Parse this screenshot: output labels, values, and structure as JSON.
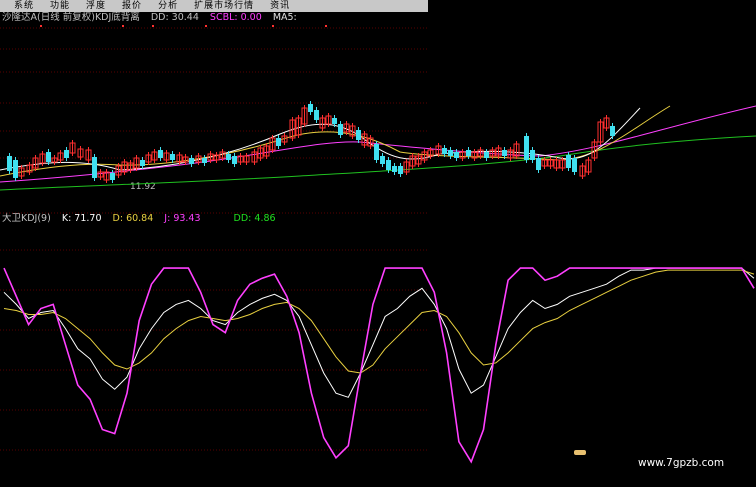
{
  "menu": [
    "系统",
    "功能",
    "浮度",
    "报价",
    "分析",
    "扩展市场行情",
    "资讯"
  ],
  "main_panel": {
    "stock_label": "沙隆达A(日线 前复权)",
    "indicator_label": "KDJ底背离",
    "dd_label": "DD: 30.44",
    "scbl_label": "SCBL: 0.00",
    "ma_label": "MA5:",
    "low_marker": "11.92"
  },
  "kdj_panel": {
    "title": "大卫KDJ(9)",
    "k": "K: 71.70",
    "d": "D: 60.84",
    "j": "J: 93.43",
    "dd": "DD: 4.86"
  },
  "watermark": "www.7gpzb.com",
  "colors": {
    "bg": "#000000",
    "up": "#ff3030",
    "down": "#40e0f0",
    "k_line": "#ffffff",
    "d_line": "#e8d040",
    "j_line": "#ff40ff",
    "grid": "#b00000",
    "ma_white": "#ffffff",
    "ma_yellow": "#e8d040",
    "ma_pink": "#ff40ff",
    "ma_green": "#20c020"
  },
  "chart_data": {
    "type": "line",
    "series": [
      {
        "name": "K",
        "values": [
          88,
          82,
          75,
          78,
          79,
          70,
          60,
          55,
          45,
          40,
          46,
          60,
          70,
          78,
          82,
          84,
          80,
          74,
          72,
          78,
          82,
          85,
          87,
          84,
          76,
          62,
          48,
          38,
          36,
          48,
          62,
          76,
          80,
          86,
          90,
          82,
          70,
          50,
          38,
          42,
          56,
          70,
          78,
          84,
          80,
          82,
          86,
          88,
          90,
          92,
          96,
          99,
          99,
          100,
          100,
          100,
          100,
          100,
          100,
          100,
          100,
          95
        ]
      },
      {
        "name": "D",
        "values": [
          80,
          79,
          77,
          77,
          78,
          75,
          70,
          65,
          58,
          52,
          50,
          53,
          58,
          65,
          70,
          74,
          76,
          75,
          74,
          75,
          77,
          80,
          82,
          83,
          80,
          74,
          65,
          56,
          49,
          48,
          52,
          60,
          66,
          72,
          78,
          79,
          76,
          68,
          58,
          52,
          53,
          58,
          64,
          70,
          73,
          75,
          79,
          82,
          85,
          88,
          91,
          94,
          96,
          98,
          99,
          99,
          99,
          99,
          99,
          99,
          99,
          97
        ]
      },
      {
        "name": "J",
        "values": [
          100,
          86,
          72,
          80,
          82,
          62,
          42,
          35,
          20,
          18,
          38,
          74,
          92,
          100,
          100,
          100,
          88,
          72,
          68,
          84,
          92,
          95,
          97,
          86,
          68,
          38,
          16,
          6,
          12,
          48,
          82,
          100,
          100,
          100,
          100,
          88,
          58,
          14,
          4,
          20,
          62,
          94,
          100,
          100,
          94,
          96,
          100,
          100,
          100,
          100,
          100,
          100,
          100,
          100,
          100,
          100,
          100,
          100,
          100,
          100,
          100,
          90
        ]
      }
    ]
  }
}
